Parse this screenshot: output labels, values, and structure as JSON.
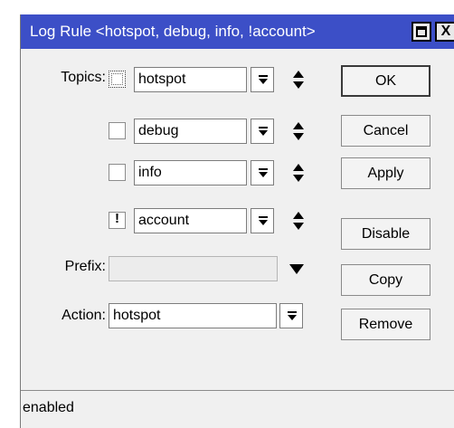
{
  "window": {
    "title": "Log Rule <hotspot, debug, info, !account>",
    "maximize_label": "",
    "close_label": "X"
  },
  "topics": {
    "label": "Topics:",
    "items": [
      {
        "value": "hotspot",
        "state": "dotted"
      },
      {
        "value": "debug",
        "state": "unchecked"
      },
      {
        "value": "info",
        "state": "unchecked"
      },
      {
        "value": "account",
        "state": "negated",
        "mark": "!"
      }
    ]
  },
  "prefix": {
    "label": "Prefix:",
    "value": ""
  },
  "action": {
    "label": "Action:",
    "value": "hotspot"
  },
  "buttons": {
    "ok": "OK",
    "cancel": "Cancel",
    "apply": "Apply",
    "disable": "Disable",
    "copy": "Copy",
    "remove": "Remove"
  },
  "status": {
    "text": "enabled"
  },
  "colors": {
    "titlebar": "#3c4fc7",
    "window_bg": "#f0f0f0"
  },
  "icons": {
    "dropdown": "dropdown-arrow-icon",
    "updown": "up-down-arrows-icon",
    "maximize": "maximize-icon",
    "close": "close-icon"
  }
}
